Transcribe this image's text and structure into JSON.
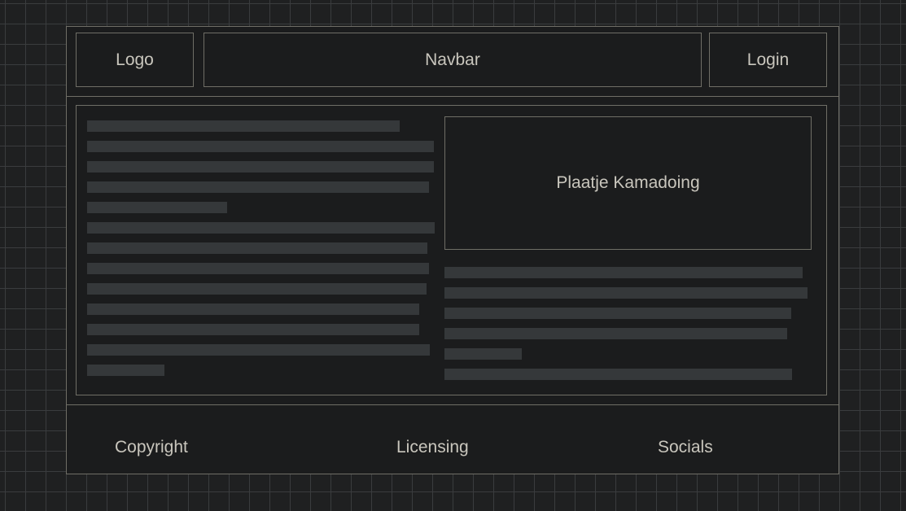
{
  "header": {
    "logo_label": "Logo",
    "navbar_label": "Navbar",
    "login_label": "Login"
  },
  "main": {
    "image_label": "Plaatje Kamadoing",
    "left_text_line_count": 13,
    "right_text_line_count": 6
  },
  "footer": {
    "copyright_label": "Copyright",
    "licensing_label": "Licensing",
    "socials_label": "Socials"
  },
  "colors": {
    "page_background": "#1f2021",
    "grid_line": "#3a3c3e",
    "frame_background": "#1b1c1d",
    "border": "#6f6e66",
    "placeholder_bar": "#35383a",
    "text": "#c9c6bd"
  }
}
